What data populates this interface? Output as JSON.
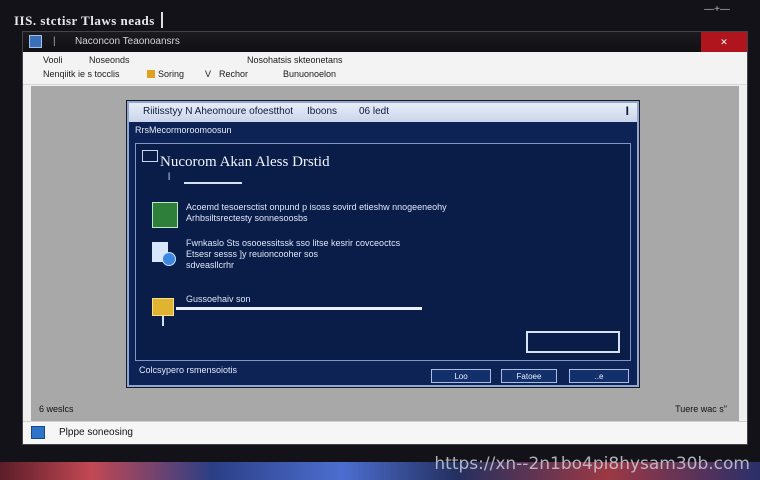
{
  "screen": {
    "top_title": "IIS. stctisr Tlaws neads",
    "top_right_marks": "—+—"
  },
  "window": {
    "titlebar": {
      "sep": "|",
      "title": "Naconcon Teaonoansrs"
    },
    "menubar": {
      "items": [
        {
          "label": "Vooli"
        },
        {
          "label": "Noseonds"
        },
        {
          "label": "Nosohatsis skteonetans"
        },
        {
          "label": "Nenqiitk ie s tocclis"
        },
        {
          "label": "Soring"
        },
        {
          "label": "V"
        },
        {
          "label": "Rechor"
        },
        {
          "label": "Bunuonoelon"
        }
      ]
    },
    "content": {
      "left_label": "6 weslcs",
      "right_label": "Tuere wac s\""
    },
    "statusbar": {
      "text": "Plppe soneosing"
    }
  },
  "dialog": {
    "title_left": "Riitisstyy N Aheomoure ofoestthot",
    "title_mid": "Iboons",
    "title_right": "06 ledt",
    "subtitle": "RrsMecormoroomoosun",
    "panel": {
      "heading": "Nucorom Akan Aless Drstid",
      "small_label": "l",
      "items": [
        {
          "icon": "green-shield-icon",
          "lines": [
            "Acoemd tesoersctist onpund p isoss sovird etieshw nnogeeneohy",
            "Arhbsiltsrectesty sonnesoosbs"
          ]
        },
        {
          "icon": "user-globe-icon",
          "lines": [
            "Fwnkaslo Sts osooessitssk sso litse kesrir covceoctcs",
            "Etsesr sesss ]y reuioncooher sos",
            "sdveasllcrhr"
          ]
        },
        {
          "icon": "folder-icon",
          "lines": [
            "Gussoehaiv son"
          ]
        }
      ],
      "progress": 1.0
    },
    "footer_text": "Colcsypero rsmensoiotis",
    "buttons": {
      "ok": "Loo",
      "cancel": "Fatoee",
      "help": "..e"
    }
  },
  "watermark": "https://xn--2n1bo4pi8hysam30b.com"
}
